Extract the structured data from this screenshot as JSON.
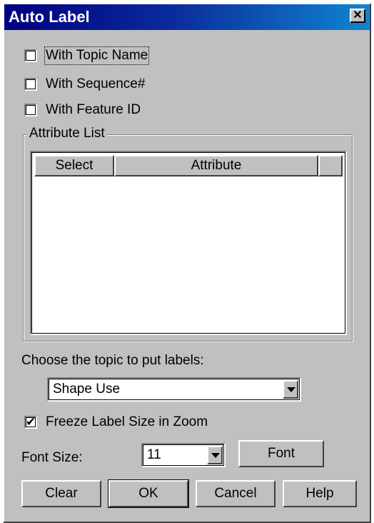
{
  "window": {
    "title": "Auto Label",
    "close_glyph": "✕"
  },
  "options": {
    "with_topic_name": {
      "label": "With Topic Name",
      "checked": false
    },
    "with_sequence": {
      "label": "With Sequence#",
      "checked": false
    },
    "with_feature_id": {
      "label": "With Feature ID",
      "checked": false
    }
  },
  "attribute_list": {
    "title": "Attribute List",
    "columns": [
      "Select",
      "Attribute",
      ""
    ],
    "rows": []
  },
  "topic": {
    "label": "Choose the topic to put labels:",
    "selected": "Shape Use"
  },
  "freeze": {
    "label": "Freeze Label Size in Zoom",
    "checked": true,
    "check_glyph": "✔"
  },
  "font_size": {
    "label": "Font Size:",
    "value": "11",
    "font_button": "Font"
  },
  "buttons": {
    "clear": "Clear",
    "ok": "OK",
    "cancel": "Cancel",
    "help": "Help"
  }
}
